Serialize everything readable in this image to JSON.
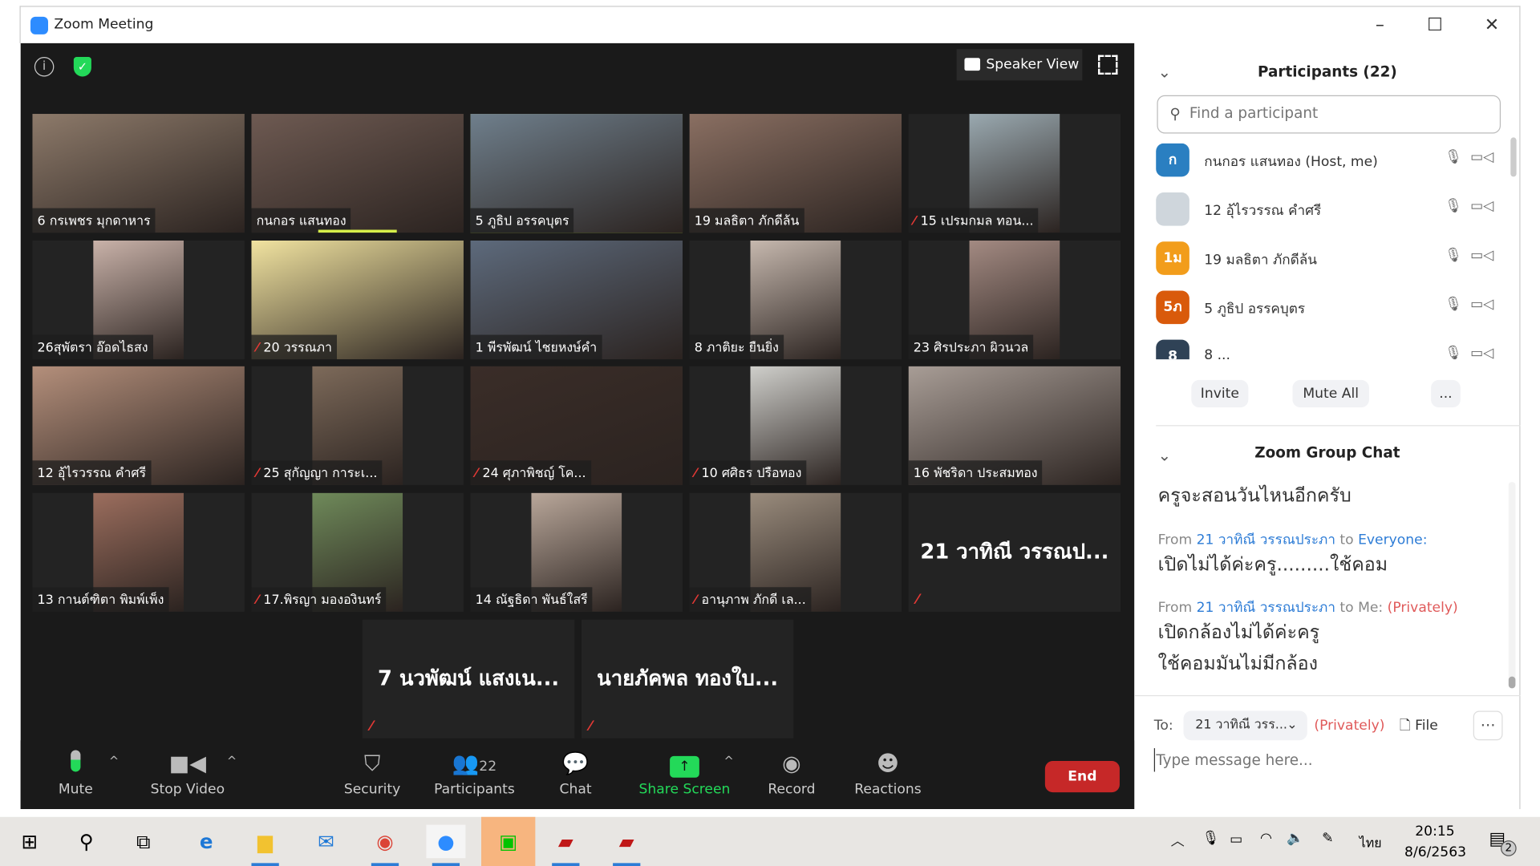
{
  "window": {
    "title": "Zoom Meeting",
    "minimize": "–",
    "maximize": "☐",
    "close": "✕"
  },
  "video": {
    "speaker_view_label": "Speaker View",
    "tiles": [
      {
        "name": "6 กรเพชร  มุกดาหาร",
        "muted": false,
        "video": true,
        "color": "#8d7a6a"
      },
      {
        "name": "กนกอร แสนทอง",
        "muted": false,
        "video": true,
        "color": "#6e5a52",
        "speaking": true
      },
      {
        "name": "5 ภูธิป อรรคบุตร",
        "muted": false,
        "video": true,
        "color": "#6f7f8c",
        "active": true
      },
      {
        "name": "19 มลธิตา ภักดีล้น",
        "muted": false,
        "video": true,
        "color": "#8a6f62"
      },
      {
        "name": "15 เปรมกมล ทอน...",
        "muted": true,
        "video": true,
        "color": "#9aa9b0",
        "narrow": true
      },
      {
        "name": "26สุพัตรา อ๊อดไธสง",
        "muted": false,
        "video": true,
        "color": "#c9b2a9",
        "narrow": true
      },
      {
        "name": "20 วรรณภา",
        "muted": true,
        "video": true,
        "color": "#f1e3a0"
      },
      {
        "name": "1 พีรพัฒน์ ไชยหงษ์คำ",
        "muted": false,
        "video": true,
        "color": "#5d6a7c"
      },
      {
        "name": "8 ภาติยะ ยืนยิ่ง",
        "muted": false,
        "video": true,
        "color": "#c6b8ae",
        "narrow": true
      },
      {
        "name": "23 ศิรประภา ผิวนวล",
        "muted": false,
        "video": true,
        "color": "#a38a82",
        "narrow": true
      },
      {
        "name": "12 อุ้ไรวรรณ คำศรี",
        "muted": false,
        "video": true,
        "color": "#b48f7b"
      },
      {
        "name": "25 สุกัญญา การะเ...",
        "muted": true,
        "video": true,
        "color": "#7d6a5a",
        "narrow": true
      },
      {
        "name": "24 ศุภาพิชญ์ โค...",
        "muted": true,
        "video": true,
        "color": "#3a2d28"
      },
      {
        "name": "10 ศศิธร ปรือทอง",
        "muted": true,
        "video": true,
        "color": "#cfcfcb",
        "narrow": true
      },
      {
        "name": "16 พัชริดา ประสมทอง",
        "muted": false,
        "video": true,
        "color": "#a89d96"
      },
      {
        "name": "13 กานต์ฑิตา พิมพ์เพ็ง",
        "muted": false,
        "video": true,
        "color": "#9c6e5e",
        "narrow": true
      },
      {
        "name": "17.พิรญา มององินทร์",
        "muted": true,
        "video": true,
        "color": "#6f8a5a",
        "narrow": true
      },
      {
        "name": "14 ณัฐธิดา พันธ์ใสรี",
        "muted": false,
        "video": true,
        "color": "#b9a79a",
        "narrow": true
      },
      {
        "name": "อานุภาพ  ภักดี เล...",
        "muted": true,
        "video": true,
        "color": "#9a8c7d",
        "narrow": true
      },
      {
        "name": "21 วาทิณี วรรณป...",
        "muted": true,
        "video": false
      },
      {
        "name": "7 นวพัฒน์ แสงเน...",
        "muted": true,
        "video": false
      },
      {
        "name": "นายภัคพล ทองใบ...",
        "muted": true,
        "video": false
      }
    ]
  },
  "toolbar": {
    "mute": "Mute",
    "stop_video": "Stop Video",
    "security": "Security",
    "participants": "Participants",
    "participants_count": "22",
    "chat": "Chat",
    "share_screen": "Share Screen",
    "record": "Record",
    "reactions": "Reactions",
    "end": "End",
    "share_color": "#23d959",
    "end_color": "#c62828"
  },
  "participants": {
    "title": "Participants (22)",
    "search_placeholder": "Find a participant",
    "list": [
      {
        "initial": "ก",
        "name": "กนกอร แสนทอง (Host, me)",
        "color": "#2a7fc1"
      },
      {
        "initial": "",
        "name": "12 อุ้ไรวรรณ คำศรี",
        "color": "#cfd6dc"
      },
      {
        "initial": "1ม",
        "name": "19 มลธิตา ภักดีล้น",
        "color": "#f29d1b"
      },
      {
        "initial": "5ภ",
        "name": "5 ภูธิป อรรคบุตร",
        "color": "#d95a0b"
      },
      {
        "initial": "8",
        "name": "8 ...",
        "color": "#2f4256"
      }
    ],
    "invite": "Invite",
    "mute_all": "Mute All",
    "more": "..."
  },
  "chat": {
    "title": "Zoom Group Chat",
    "msg0": "ครูจะสอนวันไหนอีกครับ",
    "from1": "From",
    "sender1": "21 วาทิณี วรรณประภา",
    "to1": "to",
    "recipient1": "Everyone:",
    "msg1": "เปิดไม่ได้ค่ะครู.........ใช้คอม",
    "from2": "From",
    "sender2": "21 วาทิณี วรรณประภา",
    "to2": "to Me:",
    "private2": "(Privately)",
    "msg2a": "เปิดกล้องไม่ได้ค่ะครู",
    "msg2b": "ใช้คอมมันไม่มีกล้อง",
    "to_label": "To:",
    "to_value": "21 วาทิณี วรร...",
    "privately": "(Privately)",
    "file": "File",
    "more": "···",
    "input_placeholder": "Type message here..."
  },
  "taskbar": {
    "time": "20:15",
    "date": "8/6/2563",
    "language": "ไทย",
    "notifications": "2"
  }
}
